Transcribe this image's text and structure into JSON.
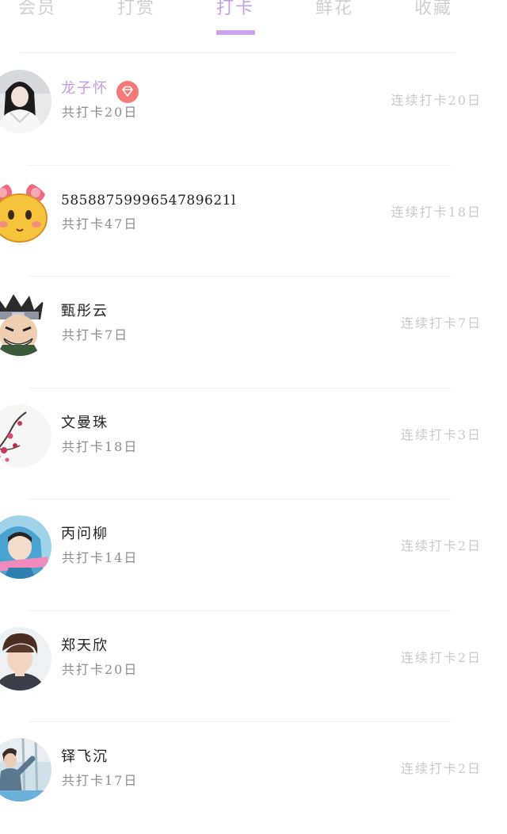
{
  "tabs": [
    {
      "label": "会员",
      "active": false
    },
    {
      "label": "打赏",
      "active": false
    },
    {
      "label": "打卡",
      "active": true
    },
    {
      "label": "鲜花",
      "active": false
    },
    {
      "label": "收藏",
      "active": false
    }
  ],
  "list": [
    {
      "name": "龙子怀",
      "vip": true,
      "total": "共打卡20日",
      "streak": "连续打卡20日",
      "avatar_icon": "girl-photo-avatar"
    },
    {
      "name": "5858875999654789621l",
      "vip": false,
      "total": "共打卡47日",
      "streak": "连续打卡18日",
      "avatar_icon": "cartoon-face-avatar"
    },
    {
      "name": "甄彤云",
      "vip": false,
      "total": "共打卡7日",
      "streak": "连续打卡7日",
      "avatar_icon": "anime-ninja-avatar"
    },
    {
      "name": "文曼珠",
      "vip": false,
      "total": "共打卡18日",
      "streak": "连续打卡3日",
      "avatar_icon": "plum-blossom-avatar"
    },
    {
      "name": "丙问柳",
      "vip": false,
      "total": "共打卡14日",
      "streak": "连续打卡2日",
      "avatar_icon": "hooded-girl-avatar"
    },
    {
      "name": "郑天欣",
      "vip": false,
      "total": "共打卡20日",
      "streak": "连续打卡2日",
      "avatar_icon": "boy-portrait-avatar"
    },
    {
      "name": "铎飞沉",
      "vip": false,
      "total": "共打卡17日",
      "streak": "连续打卡2日",
      "avatar_icon": "outdoor-boy-avatar"
    }
  ],
  "colors": {
    "accent": "#c5a1e4",
    "vip_name": "#c69be8",
    "vip_badge": "#f57a78",
    "tab_inactive": "#cfcfcf",
    "name": "#222222",
    "total": "#8c8c8c",
    "streak": "#c9c9c9"
  }
}
